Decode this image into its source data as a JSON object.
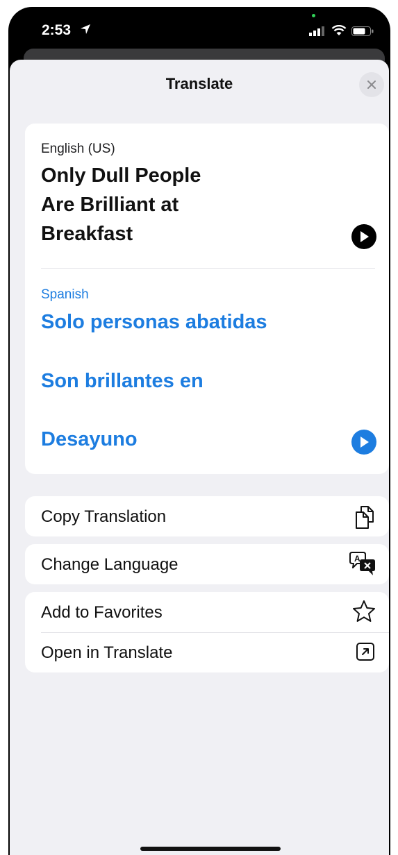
{
  "status_bar": {
    "time": "2:53"
  },
  "sheet": {
    "title": "Translate"
  },
  "source": {
    "language": "English (US)",
    "lines": [
      "Only Dull People",
      "Are Brilliant at",
      "Breakfast"
    ]
  },
  "target": {
    "language": "Spanish",
    "lines": [
      "Solo personas abatidas",
      "Son brillantes en",
      "Desayuno"
    ]
  },
  "actions": {
    "copy_translation": "Copy Translation",
    "change_language": "Change Language",
    "add_to_favorites": "Add to Favorites",
    "open_in_translate": "Open in Translate"
  },
  "icons": {
    "close": "close-icon",
    "play": "play-icon",
    "copy": "copy-icon",
    "translate": "translate-icon",
    "star": "star-icon",
    "open_external": "open-external-icon"
  },
  "colors": {
    "accent": "#1d7de0",
    "sheet_background": "#f0f0f4"
  }
}
